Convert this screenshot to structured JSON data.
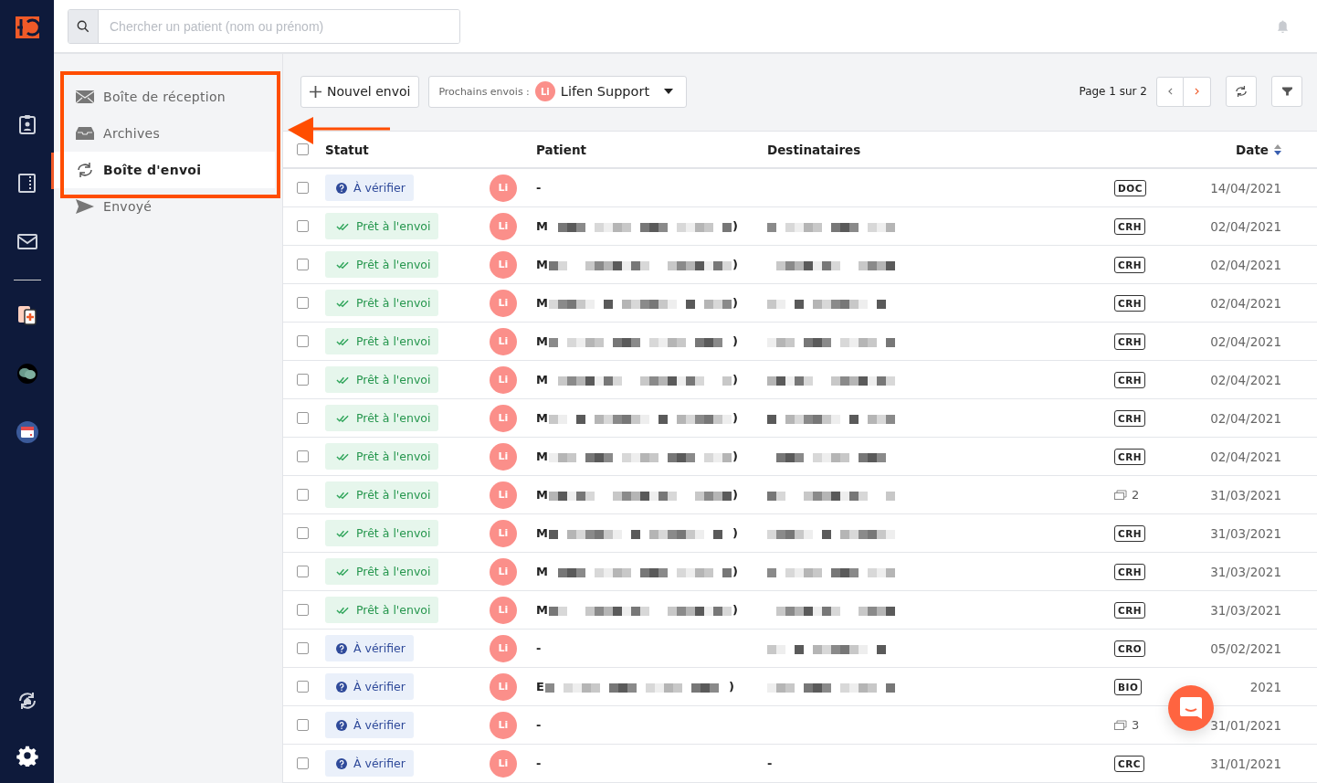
{
  "search": {
    "placeholder": "Chercher un patient (nom ou prénom)"
  },
  "sidebar": {
    "items": [
      {
        "kind": "inbox",
        "label": "Boîte de réception",
        "selected": false
      },
      {
        "kind": "archive",
        "label": "Archives",
        "selected": false
      },
      {
        "kind": "outbox",
        "label": "Boîte d'envoi",
        "selected": true
      },
      {
        "kind": "sent",
        "label": "Envoyé",
        "selected": false
      }
    ]
  },
  "toolbar": {
    "new_button": "Nouvel envoi",
    "next_label": "Prochains envois :",
    "next_avatar": "Li",
    "next_name": "Lifen Support",
    "pagination": "Page 1 sur 2"
  },
  "table": {
    "select_all_checked": false,
    "columns": [
      "Statut",
      "Patient",
      "Destinataires",
      "Date"
    ],
    "rows": [
      {
        "checked": false,
        "status": {
          "kind": "verify",
          "label": "À vérifier"
        },
        "avatar": "Li",
        "patient": "-",
        "patient_redacted": false,
        "recipients_redacted": false,
        "doc": {
          "kind": "tag",
          "label": "DOC"
        },
        "date": "14/04/2021"
      },
      {
        "checked": false,
        "status": {
          "kind": "ready",
          "label": "Prêt à l'envoi"
        },
        "avatar": "Li",
        "patient": "M",
        "patient_redacted": true,
        "patient_end": ")",
        "recipients_redacted": true,
        "doc": {
          "kind": "tag",
          "label": "CRH"
        },
        "date": "02/04/2021"
      },
      {
        "checked": false,
        "status": {
          "kind": "ready",
          "label": "Prêt à l'envoi"
        },
        "avatar": "Li",
        "patient": "M",
        "patient_redacted": true,
        "patient_end": ")",
        "recipients_redacted": true,
        "doc": {
          "kind": "tag",
          "label": "CRH"
        },
        "date": "02/04/2021"
      },
      {
        "checked": false,
        "status": {
          "kind": "ready",
          "label": "Prêt à l'envoi"
        },
        "avatar": "Li",
        "patient": "M",
        "patient_redacted": true,
        "patient_end": ")",
        "recipients_redacted": true,
        "doc": {
          "kind": "tag",
          "label": "CRH"
        },
        "date": "02/04/2021"
      },
      {
        "checked": false,
        "status": {
          "kind": "ready",
          "label": "Prêt à l'envoi"
        },
        "avatar": "Li",
        "patient": "M",
        "patient_redacted": true,
        "patient_end": ")",
        "recipients_redacted": true,
        "doc": {
          "kind": "tag",
          "label": "CRH"
        },
        "date": "02/04/2021"
      },
      {
        "checked": false,
        "status": {
          "kind": "ready",
          "label": "Prêt à l'envoi"
        },
        "avatar": "Li",
        "patient": "M",
        "patient_redacted": true,
        "patient_end": ")",
        "recipients_redacted": true,
        "doc": {
          "kind": "tag",
          "label": "CRH"
        },
        "date": "02/04/2021"
      },
      {
        "checked": false,
        "status": {
          "kind": "ready",
          "label": "Prêt à l'envoi"
        },
        "avatar": "Li",
        "patient": "M",
        "patient_redacted": true,
        "patient_end": ")",
        "recipients_redacted": true,
        "doc": {
          "kind": "tag",
          "label": "CRH"
        },
        "date": "02/04/2021"
      },
      {
        "checked": false,
        "status": {
          "kind": "ready",
          "label": "Prêt à l'envoi"
        },
        "avatar": "Li",
        "patient": "M",
        "patient_redacted": true,
        "patient_end": ")",
        "recipients_redacted": true,
        "doc": {
          "kind": "tag",
          "label": "CRH"
        },
        "date": "02/04/2021"
      },
      {
        "checked": false,
        "status": {
          "kind": "ready",
          "label": "Prêt à l'envoi"
        },
        "avatar": "Li",
        "patient": "M",
        "patient_redacted": true,
        "patient_end": ")",
        "recipients_redacted": true,
        "doc": {
          "kind": "count",
          "label": "2"
        },
        "date": "31/03/2021"
      },
      {
        "checked": false,
        "status": {
          "kind": "ready",
          "label": "Prêt à l'envoi"
        },
        "avatar": "Li",
        "patient": "M",
        "patient_redacted": true,
        "patient_end": ")",
        "recipients_redacted": true,
        "doc": {
          "kind": "tag",
          "label": "CRH"
        },
        "date": "31/03/2021"
      },
      {
        "checked": false,
        "status": {
          "kind": "ready",
          "label": "Prêt à l'envoi"
        },
        "avatar": "Li",
        "patient": "M",
        "patient_redacted": true,
        "patient_end": ")",
        "recipients_redacted": true,
        "doc": {
          "kind": "tag",
          "label": "CRH"
        },
        "date": "31/03/2021"
      },
      {
        "checked": false,
        "status": {
          "kind": "ready",
          "label": "Prêt à l'envoi"
        },
        "avatar": "Li",
        "patient": "M",
        "patient_redacted": true,
        "patient_end": ")",
        "recipients_redacted": true,
        "doc": {
          "kind": "tag",
          "label": "CRH"
        },
        "date": "31/03/2021"
      },
      {
        "checked": false,
        "status": {
          "kind": "verify",
          "label": "À vérifier"
        },
        "avatar": "Li",
        "patient": "-",
        "patient_redacted": false,
        "recipients_redacted": true,
        "doc": {
          "kind": "tag",
          "label": "CRO"
        },
        "date": "05/02/2021"
      },
      {
        "checked": false,
        "status": {
          "kind": "verify",
          "label": "À vérifier"
        },
        "avatar": "Li",
        "patient": "E",
        "patient_redacted": true,
        "patient_end": ")",
        "recipients_redacted": true,
        "doc": {
          "kind": "tag",
          "label": "BIO"
        },
        "date": "2021"
      },
      {
        "checked": false,
        "status": {
          "kind": "verify",
          "label": "À vérifier"
        },
        "avatar": "Li",
        "patient": "-",
        "patient_redacted": false,
        "recipients_redacted": false,
        "doc": {
          "kind": "count",
          "label": "3"
        },
        "date": "31/01/2021"
      },
      {
        "checked": false,
        "status": {
          "kind": "verify",
          "label": "À vérifier"
        },
        "avatar": "Li",
        "patient": "-",
        "patient_redacted": false,
        "recipients_redacted": false,
        "recipients": "-",
        "doc": {
          "kind": "tag",
          "label": "CRC"
        },
        "date": "31/01/2021"
      }
    ]
  }
}
